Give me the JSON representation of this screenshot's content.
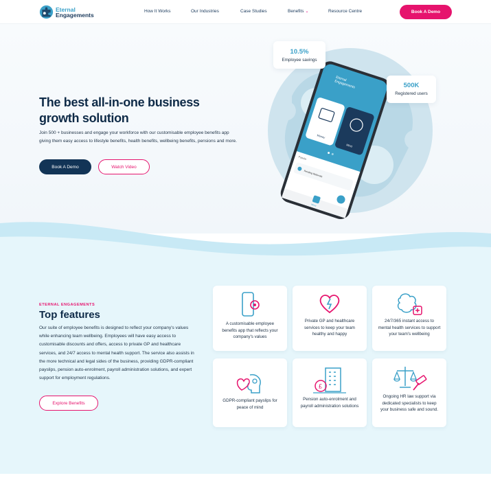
{
  "brand": {
    "line1": "Eternal",
    "line2": "Engagements"
  },
  "nav": {
    "items": [
      "How It Works",
      "Our Industries",
      "Case Studies",
      "Benefits",
      "Resource Centre"
    ],
    "cta": "Book A Demo"
  },
  "hero": {
    "title": "The best all-in-one business growth solution",
    "description": "Join 500 + businesses and engage your workforce with our customisable employee benefits app giving them easy access to lifestyle benefits, health benefits, wellbeing benefits, pensions and more.",
    "primary_cta": "Book A Demo",
    "secondary_cta": "Watch Video",
    "stats": [
      {
        "value": "10.5%",
        "label": "Employee savings"
      },
      {
        "value": "500K",
        "label": "Registered users"
      }
    ],
    "phone": {
      "brand_line1": "Eternal",
      "brand_line2": "Engagements",
      "tile1": "Money",
      "tile2": "Mind",
      "section_label": "Popular",
      "list_item": "Pending Referrals",
      "bottom_label": "Menu"
    }
  },
  "features": {
    "eyebrow": "ETERNAL ENGAGEMENTS",
    "title": "Top features",
    "description": "Our suite of employee benefits is designed to reflect your company's values while enhancing team wellbeing. Employees will have easy access to customisable discounts and offers, access to private GP and healthcare services, and 24/7 access to mental health support. The service also assists in the more technical and legal sides of the business, providing GDPR-compliant payslips, pension auto-enrolment, payroll administration solutions, and expert support for employment regulations.",
    "cta": "Explore Benefits",
    "cards": [
      {
        "icon": "phone-gear-icon",
        "text": "A customisable employee benefits app that reflects your company's values"
      },
      {
        "icon": "heart-pulse-icon",
        "text": "Private GP and healthcare services to keep your team healthy and happy"
      },
      {
        "icon": "brain-plus-icon",
        "text": "24/7/365 instant access to mental health services to support your team's wellbeing"
      },
      {
        "icon": "head-heart-icon",
        "text": "GDPR-compliant payslips for peace of mind"
      },
      {
        "icon": "building-pound-icon",
        "text": "Pension auto-enrolment and payroll administration solutions"
      },
      {
        "icon": "scales-gavel-icon",
        "text": "Ongoing HR law support via dedicated specialists to keep your business safe and sound."
      }
    ]
  },
  "colors": {
    "accent": "#e6136d",
    "brand_blue": "#3aa0c8",
    "navy": "#0e2a47"
  }
}
